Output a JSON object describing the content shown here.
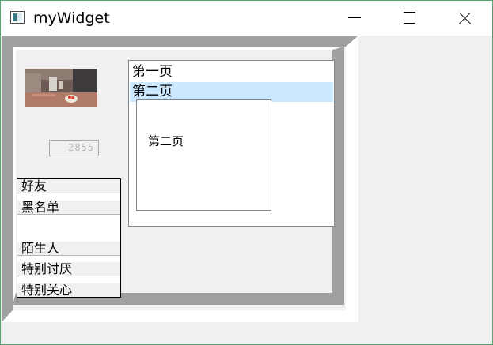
{
  "window": {
    "title": "myWidget",
    "icon": "app-window-icon",
    "controls": {
      "minimize_icon": "minimize-icon",
      "maximize_icon": "maximize-icon",
      "close_icon": "close-icon"
    }
  },
  "lcd_number": {
    "value": "2855"
  },
  "toolbox": {
    "items": [
      {
        "label": "好友"
      },
      {
        "label": "黑名单"
      },
      {
        "label": "陌生人"
      },
      {
        "label": "特别讨厌"
      },
      {
        "label": "特别关心"
      }
    ]
  },
  "list": {
    "items": [
      {
        "label": "第一页",
        "selected": false
      },
      {
        "label": "第二页",
        "selected": true
      }
    ]
  },
  "stacked_page": {
    "label": "第二页"
  },
  "colors": {
    "frame_shadow": "#a0a0a0",
    "selection": "#cce8ff",
    "window_bg": "#f0f0f0"
  }
}
